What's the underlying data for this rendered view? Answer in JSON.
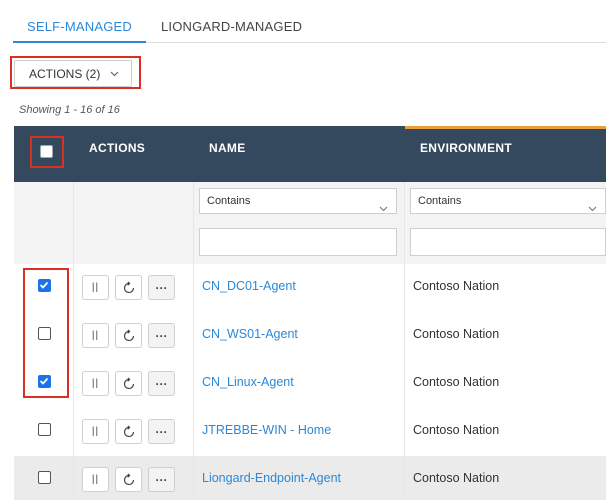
{
  "tabs": [
    {
      "label": "SELF-MANAGED",
      "active": true
    },
    {
      "label": "LIONGARD-MANAGED",
      "active": false
    }
  ],
  "actions_dropdown": {
    "label": "ACTIONS (2)"
  },
  "showing_text": "Showing 1 - 16 of 16",
  "table": {
    "columns": [
      "ACTIONS",
      "NAME",
      "ENVIRONMENT"
    ],
    "filters": {
      "name_operator": "Contains",
      "env_operator": "Contains",
      "name_value": "",
      "env_value": ""
    },
    "rows": [
      {
        "name": "CN_DC01-Agent",
        "environment": "Contoso Nation",
        "checked": true
      },
      {
        "name": "CN_WS01-Agent",
        "environment": "Contoso Nation",
        "checked": false
      },
      {
        "name": "CN_Linux-Agent",
        "environment": "Contoso Nation",
        "checked": true
      },
      {
        "name": "JTREBBE-WIN - Home",
        "environment": "Contoso Nation",
        "checked": false
      },
      {
        "name": "Liongard-Endpoint-Agent",
        "environment": "Contoso Nation",
        "checked": false
      }
    ],
    "pause_glyph": "||",
    "more_glyph": "···"
  },
  "colors": {
    "header_bg": "#34495e",
    "accent_orange": "#e8a13a",
    "link_blue": "#2b88d8",
    "highlight_red": "#d93025",
    "checkbox_blue": "#1a73e8"
  },
  "icons": [
    "chevron-down-icon",
    "pause-icon",
    "refresh-icon",
    "more-icon",
    "checkmark-icon"
  ]
}
